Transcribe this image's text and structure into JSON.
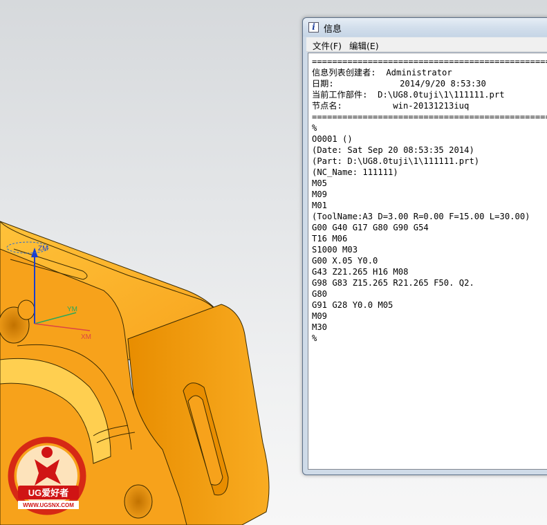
{
  "viewport": {
    "triad_labels": {
      "zm": "ZM",
      "ym": "YM",
      "xm": "XM"
    },
    "colors": {
      "part": "#f7a21b",
      "part_shade": "#b86a00",
      "background": "#e6e7e8"
    }
  },
  "info_window": {
    "title": "信息",
    "title_icon": "info-icon",
    "menu": {
      "file": "文件(F)",
      "edit": "编辑(E)"
    },
    "lines": [
      "================================================",
      "信息列表创建者:  Administrator",
      "日期:             2014/9/20 8:53:30",
      "当前工作部件:  D:\\UG8.0tuji\\1\\111111.prt",
      "节点名:          win-20131213iuq",
      "================================================",
      "%",
      "O0001 ()",
      "(Date: Sat Sep 20 08:53:35 2014)",
      "(Part: D:\\UG8.0tuji\\1\\111111.prt)",
      "(NC_Name: 111111)",
      "M05",
      "M09",
      "M01",
      "(ToolName:A3 D=3.00 R=0.00 F=15.00 L=30.00)",
      "G00 G40 G17 G80 G90 G54",
      "T16 M06",
      "S1000 M03",
      "G00 X.05 Y0.0",
      "G43 Z21.265 H16 M08",
      "G98 G83 Z15.265 R21.265 F50. Q2.",
      "G80",
      "G91 G28 Y0.0 M05",
      "M09",
      "M30",
      "%"
    ]
  },
  "logo": {
    "brand": "UG爱好者",
    "url": "WWW.UGSNX.COM"
  }
}
